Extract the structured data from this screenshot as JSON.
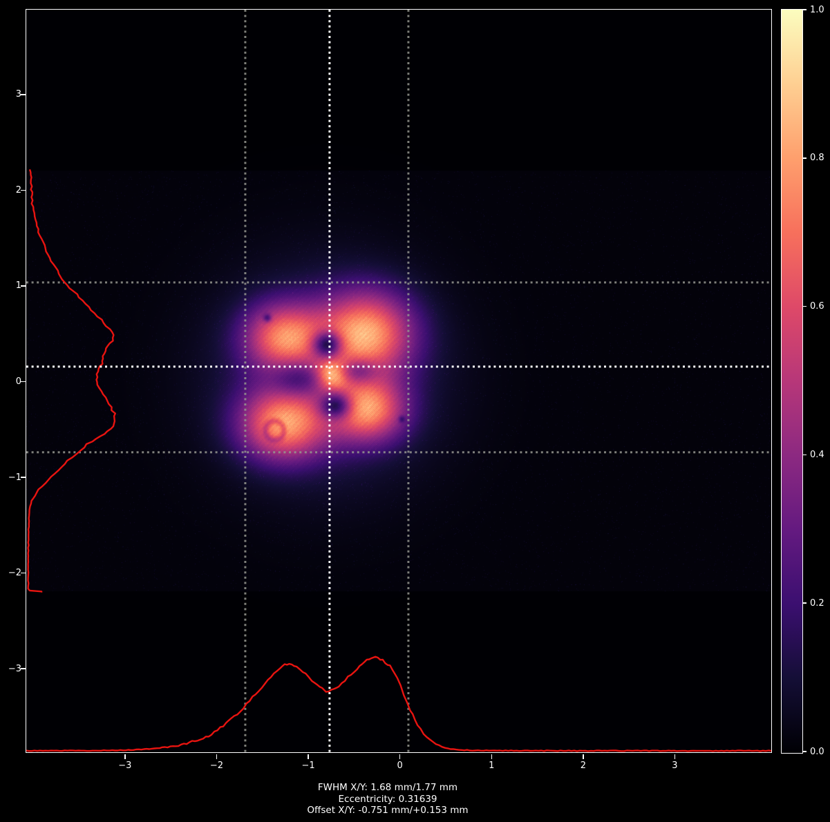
{
  "window": {
    "bg": "#000000"
  },
  "status_text": {
    "line1": "FWHM X/Y: 1.68 mm/1.77 mm",
    "line2": "Eccentricity: 0.31639",
    "line3": "Offset X/Y: -0.751 mm/+0.153 mm"
  },
  "chart_data": {
    "type": "heatmap",
    "description": "Laser beam profiler image: four-lobed beam intensity map with X/Y cross-section profiles and magma colorbar",
    "x_axis": {
      "range": [
        -4.07,
        4.06
      ],
      "ticks": [
        -3,
        -2,
        -1,
        0,
        1,
        2,
        3
      ],
      "unit": "mm"
    },
    "y_axis": {
      "range": [
        -3.88,
        3.88
      ],
      "ticks": [
        3,
        2,
        1,
        0,
        -1,
        -2,
        -3
      ],
      "unit": "mm"
    },
    "colorbar": {
      "range": [
        0.0,
        1.0
      ],
      "ticks": [
        1.0,
        0.8,
        0.6,
        0.4,
        0.2,
        0.0
      ],
      "colormap": "magma",
      "stops": [
        "#000004",
        "#140e36",
        "#3b0f70",
        "#641a80",
        "#8c2981",
        "#b73779",
        "#de4968",
        "#f7705c",
        "#fe9f6d",
        "#fecf92",
        "#fcfdbf"
      ]
    },
    "measurements": {
      "fwhm_x_mm": 1.68,
      "fwhm_y_mm": 1.77,
      "eccentricity": 0.31639,
      "offset_x_mm": -0.751,
      "offset_y_mm": 0.153
    },
    "crosshairs": {
      "center_color": "#ffffff",
      "mark_color": "#95968f",
      "x_center": -0.76,
      "y_center": 0.15,
      "x_marks": [
        -1.68,
        0.1
      ],
      "y_marks": [
        1.03,
        -0.745
      ]
    },
    "sensor_band": {
      "y_top": 2.2,
      "y_bottom": -2.2,
      "base_level": 0.013
    },
    "beam": {
      "lobes": [
        {
          "x": -1.25,
          "y": 0.46,
          "sx": 0.3,
          "sy": 0.24,
          "a": 0.6
        },
        {
          "x": -0.36,
          "y": 0.5,
          "sx": 0.35,
          "sy": 0.3,
          "a": 0.68
        },
        {
          "x": -1.26,
          "y": -0.45,
          "sx": 0.33,
          "sy": 0.26,
          "a": 0.66
        },
        {
          "x": -0.34,
          "y": -0.3,
          "sx": 0.28,
          "sy": 0.23,
          "a": 0.62
        },
        {
          "x": -0.74,
          "y": 0.06,
          "sx": 0.13,
          "sy": 0.11,
          "a": 0.55
        },
        {
          "x": -0.8,
          "y": 0.05,
          "sx": 0.8,
          "sy": 0.74,
          "a": 0.22
        }
      ],
      "nulls": [
        {
          "x": -0.79,
          "y": 0.38,
          "sx": 0.11,
          "sy": 0.1,
          "d": 0.82
        },
        {
          "x": -0.7,
          "y": -0.26,
          "sx": 0.12,
          "sy": 0.1,
          "d": 0.78
        },
        {
          "x": -1.1,
          "y": 0.02,
          "sx": 0.22,
          "sy": 0.12,
          "d": 0.5
        },
        {
          "x": -0.45,
          "y": 0.1,
          "sx": 0.16,
          "sy": 0.09,
          "d": 0.42
        }
      ],
      "ring_artifact": {
        "x": -1.36,
        "y": -0.52,
        "r": 0.1,
        "depth": 0.22
      },
      "specks": [
        {
          "x": -1.44,
          "y": 0.66,
          "r": 0.03,
          "d": 0.55
        },
        {
          "x": 0.03,
          "y": -0.4,
          "r": 0.025,
          "d": 0.5
        }
      ]
    },
    "profiles": {
      "color": "#e81410",
      "x_profile": {
        "max_height_frac": 0.128,
        "points": [
          [
            -4.07,
            0.008
          ],
          [
            -3.5,
            0.009
          ],
          [
            -3.1,
            0.012
          ],
          [
            -2.9,
            0.018
          ],
          [
            -2.7,
            0.028
          ],
          [
            -2.5,
            0.05
          ],
          [
            -2.35,
            0.08
          ],
          [
            -2.2,
            0.12
          ],
          [
            -2.05,
            0.18
          ],
          [
            -1.92,
            0.27
          ],
          [
            -1.8,
            0.37
          ],
          [
            -1.7,
            0.46
          ],
          [
            -1.6,
            0.57
          ],
          [
            -1.5,
            0.68
          ],
          [
            -1.4,
            0.78
          ],
          [
            -1.3,
            0.88
          ],
          [
            -1.25,
            0.92
          ],
          [
            -1.2,
            0.925
          ],
          [
            -1.12,
            0.89
          ],
          [
            -1.02,
            0.81
          ],
          [
            -0.92,
            0.72
          ],
          [
            -0.84,
            0.66
          ],
          [
            -0.8,
            0.63
          ],
          [
            -0.74,
            0.645
          ],
          [
            -0.66,
            0.69
          ],
          [
            -0.56,
            0.78
          ],
          [
            -0.46,
            0.87
          ],
          [
            -0.38,
            0.94
          ],
          [
            -0.3,
            0.99
          ],
          [
            -0.26,
            1.0
          ],
          [
            -0.18,
            0.96
          ],
          [
            -0.1,
            0.9
          ],
          [
            -0.02,
            0.78
          ],
          [
            0.05,
            0.6
          ],
          [
            0.12,
            0.44
          ],
          [
            0.2,
            0.28
          ],
          [
            0.3,
            0.15
          ],
          [
            0.4,
            0.07
          ],
          [
            0.5,
            0.035
          ],
          [
            0.62,
            0.02
          ],
          [
            0.8,
            0.012
          ],
          [
            1.1,
            0.009
          ],
          [
            2.0,
            0.008
          ],
          [
            3.0,
            0.008
          ],
          [
            4.06,
            0.008
          ]
        ]
      },
      "y_profile": {
        "max_width_frac": 0.119,
        "points": [
          [
            2.21,
            0.035
          ],
          [
            2.1,
            0.05
          ],
          [
            2.0,
            0.045
          ],
          [
            1.92,
            0.06
          ],
          [
            1.82,
            0.065
          ],
          [
            1.72,
            0.085
          ],
          [
            1.62,
            0.11
          ],
          [
            1.52,
            0.145
          ],
          [
            1.42,
            0.19
          ],
          [
            1.32,
            0.24
          ],
          [
            1.22,
            0.3
          ],
          [
            1.12,
            0.36
          ],
          [
            1.03,
            0.42
          ],
          [
            0.94,
            0.52
          ],
          [
            0.84,
            0.63
          ],
          [
            0.74,
            0.73
          ],
          [
            0.64,
            0.84
          ],
          [
            0.54,
            0.93
          ],
          [
            0.48,
            0.975
          ],
          [
            0.42,
            0.965
          ],
          [
            0.34,
            0.9
          ],
          [
            0.26,
            0.86
          ],
          [
            0.18,
            0.845
          ],
          [
            0.1,
            0.795
          ],
          [
            0.04,
            0.785
          ],
          [
            -0.04,
            0.8
          ],
          [
            -0.14,
            0.855
          ],
          [
            -0.24,
            0.925
          ],
          [
            -0.34,
            0.985
          ],
          [
            -0.42,
            1.0
          ],
          [
            -0.5,
            0.95
          ],
          [
            -0.58,
            0.83
          ],
          [
            -0.66,
            0.68
          ],
          [
            -0.73,
            0.595
          ],
          [
            -0.8,
            0.5
          ],
          [
            -0.9,
            0.385
          ],
          [
            -1.0,
            0.27
          ],
          [
            -1.1,
            0.165
          ],
          [
            -1.2,
            0.085
          ],
          [
            -1.28,
            0.045
          ],
          [
            -1.38,
            0.025
          ],
          [
            -1.55,
            0.018
          ],
          [
            -1.8,
            0.015
          ],
          [
            -2.0,
            0.015
          ],
          [
            -2.17,
            0.015
          ],
          [
            -2.19,
            0.03
          ],
          [
            -2.2,
            0.16
          ],
          [
            -2.21,
            0.165
          ]
        ]
      }
    }
  }
}
